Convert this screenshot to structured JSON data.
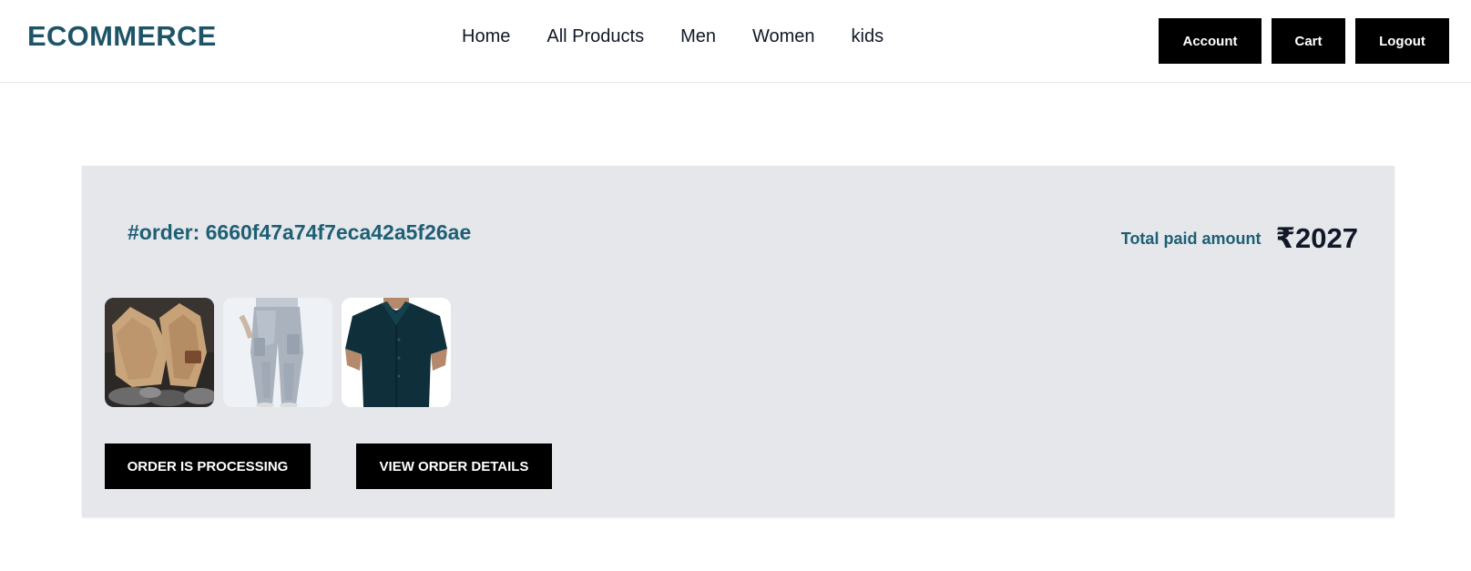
{
  "header": {
    "logo": "ECOMMERCE",
    "nav": [
      "Home",
      "All Products",
      "Men",
      "Women",
      "kids"
    ],
    "buttons": {
      "account": "Account",
      "cart": "Cart",
      "logout": "Logout"
    }
  },
  "order": {
    "id_text": "#order: 6660f47a74f7eca42a5f26ae",
    "total_label": "Total paid amount",
    "total_value": "₹2027",
    "items": [
      {
        "kind": "suede-boots"
      },
      {
        "kind": "grey-cargo-pants"
      },
      {
        "kind": "dark-teal-shirt"
      }
    ],
    "status_button": "ORDER IS PROCESSING",
    "details_button": "VIEW ORDER DETAILS"
  },
  "colors": {
    "brand": "#1e5468",
    "order_text": "#1e5f74",
    "card_bg": "#e5e7eb",
    "button_bg": "#000000"
  }
}
